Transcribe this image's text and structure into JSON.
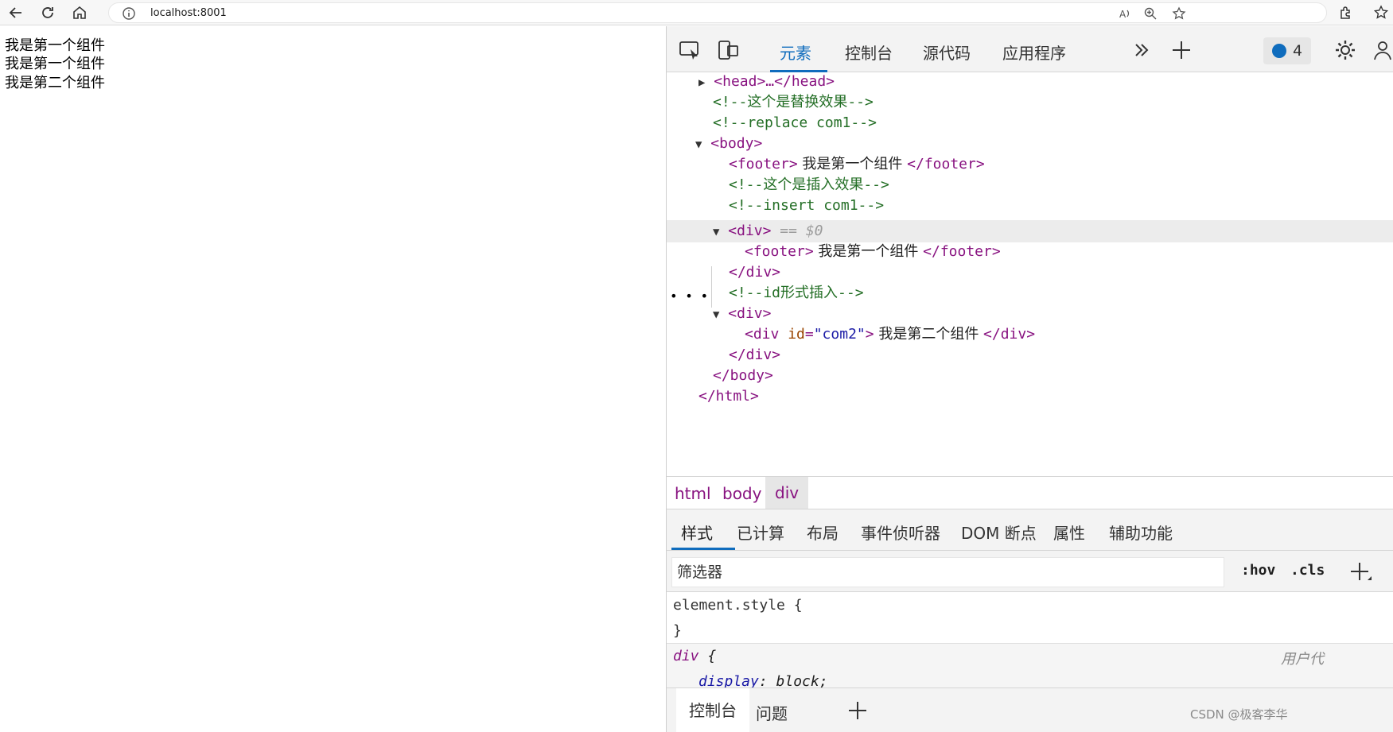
{
  "browser": {
    "url": "localhost:8001"
  },
  "page": {
    "lines": [
      "我是第一个组件",
      "我是第一个组件",
      "我是第二个组件"
    ]
  },
  "devtools": {
    "tabs": [
      "元素",
      "控制台",
      "源代码",
      "应用程序"
    ],
    "issues_count": "4",
    "dom": {
      "head": "<head>…</head>",
      "comment_replace_cn": "<!--这个是替换效果-->",
      "comment_replace": "<!--replace com1-->",
      "body_open": "<body>",
      "footer_open": "<footer>",
      "footer_text": " 我是第一个组件 ",
      "footer_close": "</footer>",
      "comment_insert_cn": "<!--这个是插入效果-->",
      "comment_insert": "<!--insert com1-->",
      "div_open": "<div>",
      "selected_marker": " == $0",
      "div_close": "</div>",
      "comment_id": "<!--id形式插入-->",
      "div_id_open_tag": "<div ",
      "div_id_attr": "id",
      "div_id_eq": "=",
      "div_id_value": "\"com2\"",
      "div_id_open_end": ">",
      "div_id_text": " 我是第二个组件 ",
      "body_close": "</body>",
      "html_close": "</html>"
    },
    "breadcrumbs": [
      "html",
      "body",
      "div"
    ],
    "style_tabs": [
      "样式",
      "已计算",
      "布局",
      "事件侦听器",
      "DOM 断点",
      "属性",
      "辅助功能"
    ],
    "filter_placeholder": "筛选器",
    "filter_hov": ":hov",
    "filter_cls": ".cls",
    "rules": {
      "element_style_open": "element.style {",
      "close_brace": "}",
      "div_selector": "div",
      "div_open": " {",
      "ua_label": "用户代",
      "prop": "display",
      "colon": ": ",
      "value": "block;"
    },
    "drawer_tabs": [
      "控制台",
      "问题"
    ],
    "watermark": "CSDN @极客李华"
  }
}
